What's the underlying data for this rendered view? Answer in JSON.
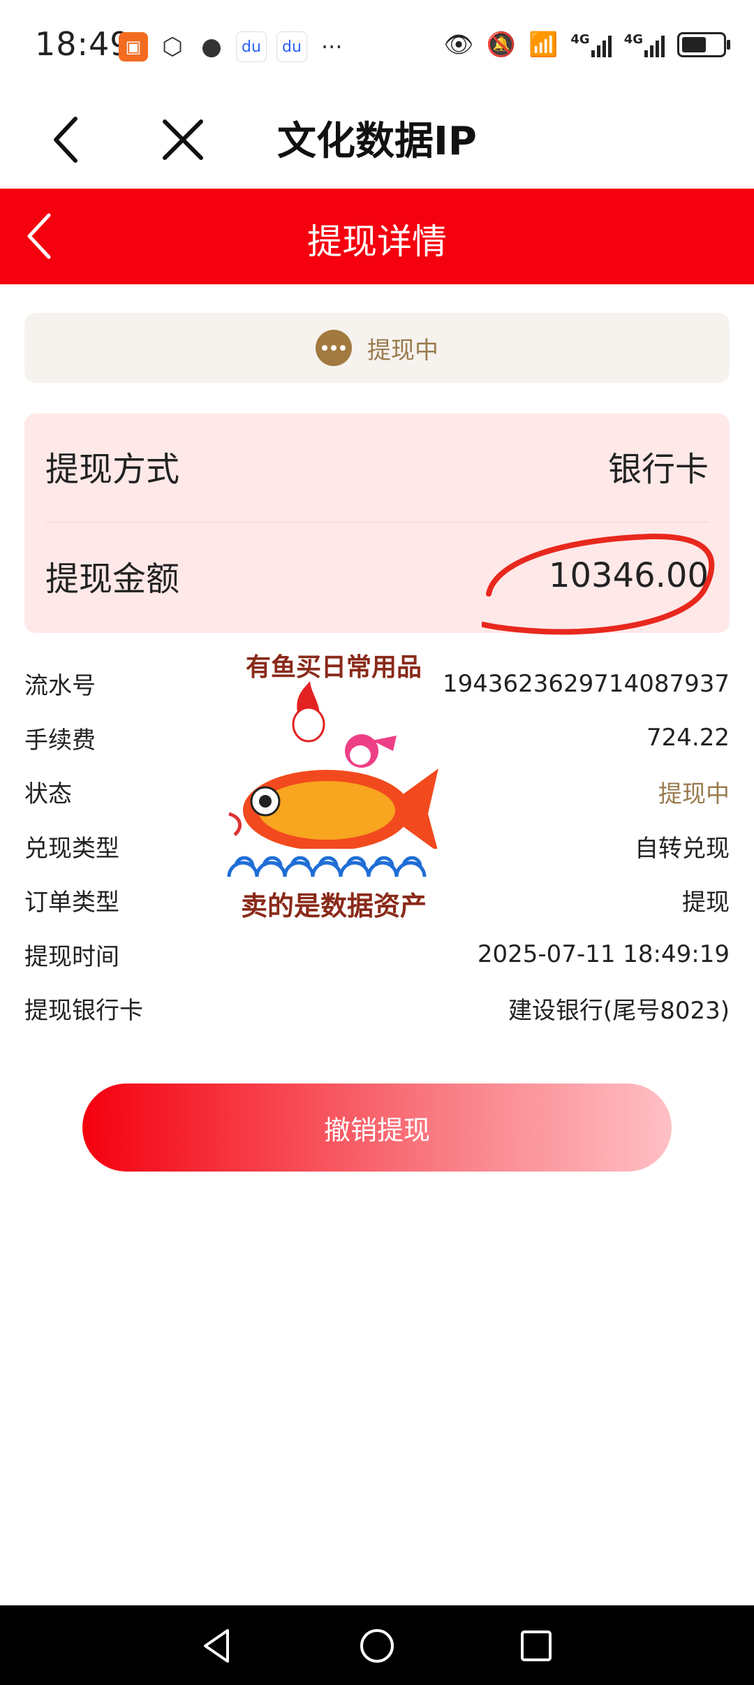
{
  "status_bar": {
    "time": "18:49",
    "left_icons": [
      "kuaishou-icon",
      "hand-icon",
      "wechat-icon",
      "baidu-icon",
      "baidu-icon"
    ],
    "more": "···",
    "network_1": "4G",
    "network_2": "4G"
  },
  "browser": {
    "title": "文化数据IP"
  },
  "header": {
    "title": "提现详情"
  },
  "status_card": {
    "text": "提现中"
  },
  "summary": {
    "method_label": "提现方式",
    "method_value": "银行卡",
    "amount_label": "提现金额",
    "amount_value": "10346.00"
  },
  "details": [
    {
      "label": "流水号",
      "value": "1943623629714087937"
    },
    {
      "label": "手续费",
      "value": "724.22"
    },
    {
      "label": "状态",
      "value": "提现中",
      "accent": true
    },
    {
      "label": "兑现类型",
      "value": "自转兑现"
    },
    {
      "label": "订单类型",
      "value": "提现"
    },
    {
      "label": "提现时间",
      "value": "2025-07-11 18:49:19"
    },
    {
      "label": "提现银行卡",
      "value": "建设银行(尾号8023)"
    }
  ],
  "sticker": {
    "top_text": "有鱼买日常用品",
    "bottom_text": "卖的是数据资产"
  },
  "cancel_button": {
    "label": "撤销提现"
  },
  "colors": {
    "brand_red": "#f5000f",
    "status_gold": "#9a7b4f",
    "annotation_red": "#e8281e"
  }
}
